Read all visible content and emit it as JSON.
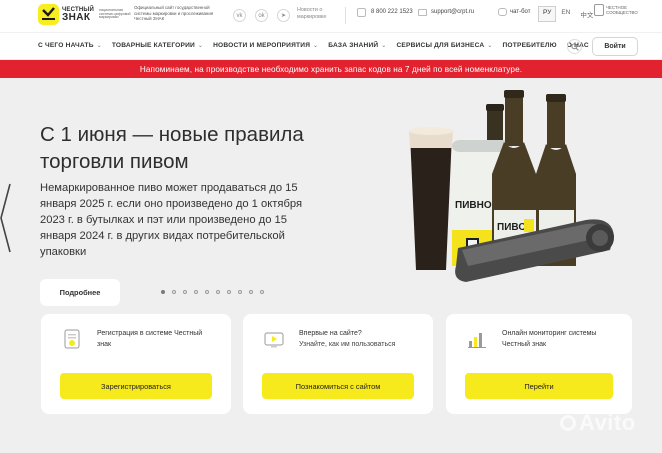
{
  "header": {
    "logo": {
      "line1": "ЧЕСТНЫЙ",
      "line2": "ЗНАК",
      "sub": "национальная система цифровой маркировки"
    },
    "site_desc": "Официальный сайт государственной системы маркировки и прослеживания Честный ЗНАК",
    "socials": [
      {
        "icon": "vk-icon",
        "glyph": "vk"
      },
      {
        "icon": "ok-icon",
        "glyph": "ok"
      },
      {
        "icon": "telegram-icon",
        "glyph": "➤"
      }
    ],
    "news_link": "Новости о маркировке",
    "phone": "8 800 222 1523",
    "email": "support@crpt.ru",
    "chat": "чат-бот",
    "languages": [
      "РУ",
      "EN",
      "中文"
    ],
    "active_language": "РУ",
    "partner": "ЧЕСТНОЕ СООБЩЕСТВО"
  },
  "nav": {
    "items": [
      "С ЧЕГО НАЧАТЬ",
      "ТОВАРНЫЕ КАТЕГОРИИ",
      "НОВОСТИ И МЕРОПРИЯТИЯ",
      "БАЗА ЗНАНИЙ",
      "СЕРВИСЫ ДЛЯ БИЗНЕСА",
      "ПОТРЕБИТЕЛЮ",
      "О НАС"
    ],
    "login": "Войти"
  },
  "alert": "Напоминаем, на производстве необходимо хранить запас кодов на 7 дней по всей номенклатуре.",
  "hero": {
    "title": "С 1 июня — новые правила торговли пивом",
    "text": "Немаркированное пиво может продаваться до 15 января 2025 г. если оно произведено до 1 октября 2023 г. в бутылках и пэт или произведено до 15 января 2024 г. в других видах потребительской упаковки",
    "more_button": "Подробнее",
    "slides_count": 10,
    "active_slide": 1,
    "can_label": "ПИВНОЙ НАПИТОК",
    "bottle_label": "ПИВО"
  },
  "cards": [
    {
      "icon": "document-icon",
      "title": "Регистрация в системе Честный знак",
      "subtitle": "",
      "button": "Зарегистрироваться"
    },
    {
      "icon": "video-icon",
      "title": "Впервые на сайте?",
      "subtitle": "Узнайте, как им пользоваться",
      "button": "Познакомиться с сайтом"
    },
    {
      "icon": "chart-icon",
      "title": "Онлайн мониторинг системы Честный знак",
      "subtitle": "",
      "button": "Перейти"
    }
  ],
  "watermark": "Avito",
  "colors": {
    "accent": "#f6ea1c",
    "alert": "#e2222e",
    "background": "#efefef"
  }
}
